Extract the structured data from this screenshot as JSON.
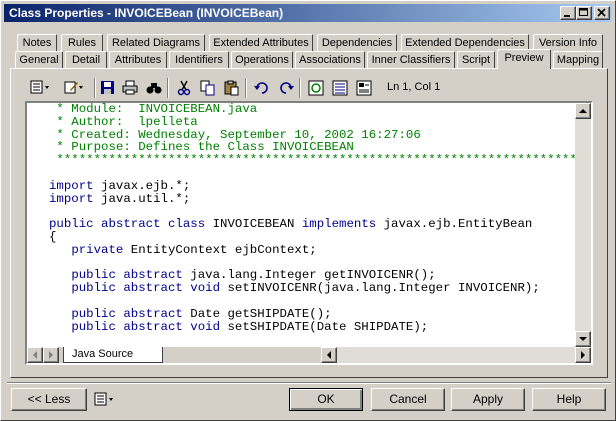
{
  "window": {
    "title": "Class Properties - INVOICEBean (INVOICEBean)"
  },
  "tabs": {
    "row1": [
      "Notes",
      "Rules",
      "Related Diagrams",
      "Extended Attributes",
      "Dependencies",
      "Extended Dependencies",
      "Version Info"
    ],
    "row2": [
      "General",
      "Detail",
      "Attributes",
      "Identifiers",
      "Operations",
      "Associations",
      "Inner Classifiers",
      "Script",
      "Preview",
      "Mapping"
    ],
    "active": "Preview"
  },
  "toolbar": {
    "icons": [
      "properties-menu-icon",
      "edit-menu-icon",
      "save-icon",
      "print-icon",
      "find-icon",
      "cut-icon",
      "copy-icon",
      "paste-icon",
      "undo-icon",
      "redo-icon",
      "refresh-icon",
      "select-all-icon",
      "insert-icon"
    ],
    "cursor_position": "Ln 1, Col 1"
  },
  "code": {
    "lines": [
      [
        {
          "t": " * Module:  INVOICEBEAN.java",
          "c": "cm"
        }
      ],
      [
        {
          "t": " * Author:  lpelleta",
          "c": "cm"
        }
      ],
      [
        {
          "t": " * Created: Wednesday, September 10, 2002 16:27:06",
          "c": "cm"
        }
      ],
      [
        {
          "t": " * Purpose: Defines the Class INVOICEBEAN",
          "c": "cm"
        }
      ],
      [
        {
          "t": " ***********************************************************************/",
          "c": "cm"
        }
      ],
      [
        {
          "t": "",
          "c": ""
        }
      ],
      [
        {
          "t": "import",
          "c": "kw"
        },
        {
          "t": " javax.ejb.*;",
          "c": ""
        }
      ],
      [
        {
          "t": "import",
          "c": "kw"
        },
        {
          "t": " java.util.*;",
          "c": ""
        }
      ],
      [
        {
          "t": "",
          "c": ""
        }
      ],
      [
        {
          "t": "public abstract class",
          "c": "kw"
        },
        {
          "t": " INVOICEBEAN ",
          "c": ""
        },
        {
          "t": "implements",
          "c": "kw"
        },
        {
          "t": " javax.ejb.EntityBean",
          "c": ""
        }
      ],
      [
        {
          "t": "{",
          "c": ""
        }
      ],
      [
        {
          "t": "   ",
          "c": ""
        },
        {
          "t": "private",
          "c": "kw"
        },
        {
          "t": " EntityContext ejbContext;",
          "c": ""
        }
      ],
      [
        {
          "t": "",
          "c": ""
        }
      ],
      [
        {
          "t": "   ",
          "c": ""
        },
        {
          "t": "public abstract",
          "c": "kw"
        },
        {
          "t": " java.lang.Integer getINVOICENR();",
          "c": ""
        }
      ],
      [
        {
          "t": "   ",
          "c": ""
        },
        {
          "t": "public abstract void",
          "c": "kw"
        },
        {
          "t": " setINVOICENR(java.lang.Integer INVOICENR);",
          "c": ""
        }
      ],
      [
        {
          "t": "",
          "c": ""
        }
      ],
      [
        {
          "t": "   ",
          "c": ""
        },
        {
          "t": "public abstract",
          "c": "kw"
        },
        {
          "t": " Date getSHIPDATE();",
          "c": ""
        }
      ],
      [
        {
          "t": "   ",
          "c": ""
        },
        {
          "t": "public abstract void",
          "c": "kw"
        },
        {
          "t": " setSHIPDATE(Date SHIPDATE);",
          "c": ""
        }
      ]
    ],
    "source_tab": "Java Source"
  },
  "buttons": {
    "less": "<< Less",
    "ok": "OK",
    "cancel": "Cancel",
    "apply": "Apply",
    "help": "Help"
  },
  "colors": {
    "comment": "#008000",
    "keyword": "#00008b",
    "title_start": "#0a246a",
    "title_end": "#a6caf0"
  }
}
